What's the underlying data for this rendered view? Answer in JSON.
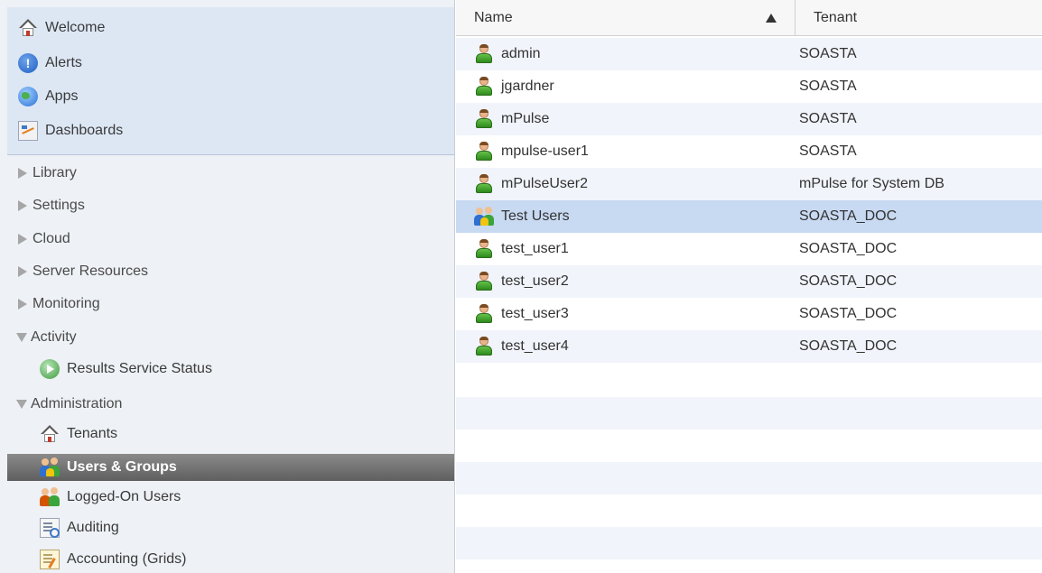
{
  "sidebar": {
    "top_items": [
      {
        "label": "Welcome",
        "icon": "home-icon"
      },
      {
        "label": "Alerts",
        "icon": "alert-icon"
      },
      {
        "label": "Apps",
        "icon": "globe-icon"
      },
      {
        "label": "Dashboards",
        "icon": "dashboard-icon"
      }
    ],
    "tree": [
      {
        "label": "Library",
        "expanded": false
      },
      {
        "label": "Settings",
        "expanded": false
      },
      {
        "label": "Cloud",
        "expanded": false
      },
      {
        "label": "Server Resources",
        "expanded": false
      },
      {
        "label": "Monitoring",
        "expanded": false
      },
      {
        "label": "Activity",
        "expanded": true
      },
      {
        "label": "Administration",
        "expanded": true
      }
    ],
    "activity_children": [
      {
        "label": "Results Service Status",
        "icon": "results-icon"
      }
    ],
    "admin_children": [
      {
        "label": "Tenants",
        "icon": "home-icon"
      },
      {
        "label": "Users & Groups",
        "icon": "users-groups-icon",
        "selected": true
      },
      {
        "label": "Logged-On Users",
        "icon": "logged-users-icon"
      },
      {
        "label": "Auditing",
        "icon": "auditing-icon"
      },
      {
        "label": "Accounting (Grids)",
        "icon": "accounting-icon"
      }
    ]
  },
  "table": {
    "columns": {
      "name": "Name",
      "tenant": "Tenant"
    },
    "sort": "ascending",
    "rows": [
      {
        "name": "admin",
        "tenant": "SOASTA",
        "type": "user"
      },
      {
        "name": "jgardner",
        "tenant": "SOASTA",
        "type": "user"
      },
      {
        "name": "mPulse",
        "tenant": "SOASTA",
        "type": "user"
      },
      {
        "name": "mpulse-user1",
        "tenant": "SOASTA",
        "type": "user"
      },
      {
        "name": "mPulseUser2",
        "tenant": "mPulse for System DB",
        "type": "user"
      },
      {
        "name": "Test Users",
        "tenant": "SOASTA_DOC",
        "type": "group",
        "selected": true
      },
      {
        "name": "test_user1",
        "tenant": "SOASTA_DOC",
        "type": "user"
      },
      {
        "name": "test_user2",
        "tenant": "SOASTA_DOC",
        "type": "user"
      },
      {
        "name": "test_user3",
        "tenant": "SOASTA_DOC",
        "type": "user"
      },
      {
        "name": "test_user4",
        "tenant": "SOASTA_DOC",
        "type": "user"
      }
    ]
  },
  "colors": {
    "selected_row": "#c8d9f2",
    "selected_nav": "#6a6a6a",
    "stripe": "#f1f4fa"
  }
}
